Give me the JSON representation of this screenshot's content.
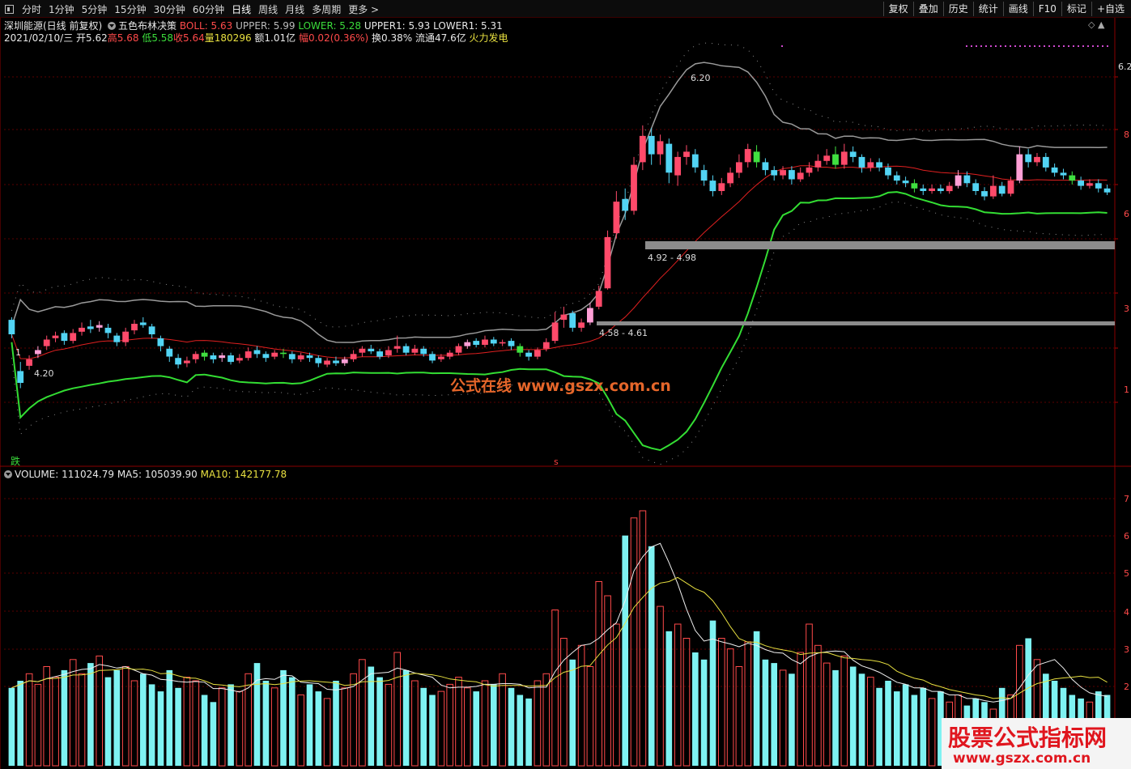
{
  "toolbar": {
    "periods": [
      "分时",
      "1分钟",
      "5分钟",
      "15分钟",
      "30分钟",
      "60分钟",
      "日线",
      "周线",
      "月线",
      "多周期",
      "更多 >"
    ],
    "active_period": "日线",
    "right_buttons": [
      "复权",
      "叠加",
      "历史",
      "统计",
      "画线",
      "F10",
      "标记",
      "+自选"
    ]
  },
  "header": {
    "stock": "深圳能源(日线 前复权)",
    "indicator": "五色布林决策",
    "boll": "BOLL: 5.63",
    "upper": "UPPER: 5.99",
    "lower": "LOWER: 5.28",
    "upper1": "UPPER1: 5.93",
    "lower1": "LOWER1: 5.31",
    "date_open": "2021/02/10/三 开5.62",
    "high": "高5.68",
    "low": "低5.58",
    "close": "收5.64",
    "volume": "量180296",
    "amount": "额1.01亿",
    "change": "幅0.02(0.36%)",
    "turnover": "换0.38%",
    "float": "流通47.6亿",
    "sector": "火力发电",
    "ctrl": "◇ ▲"
  },
  "volume_header": {
    "volume": "VOLUME: 111024.79",
    "ma5": "MA5: 105039.90",
    "ma10": "MA10: 142177.78"
  },
  "annotations": {
    "high_label": "6.20",
    "low_label": "4.20",
    "zone_upper": "4.92 - 4.98",
    "zone_lower": "4.58 - 4.61",
    "left_marker": "1",
    "die": "跌",
    "s_mark": "s"
  },
  "price_axis": [
    "6.20",
    "8",
    "6",
    "3",
    "1"
  ],
  "volume_axis": [
    "7",
    "6",
    "5",
    "4",
    "3",
    "2"
  ],
  "watermark": "公式在线  www.gszx.com.cn",
  "brand": {
    "name": "股票公式指标网",
    "url": "www.gszx.com.cn"
  },
  "colors": {
    "up": "#ff4a6a",
    "down": "#52d4f4",
    "doji_up": "#ff9fd6",
    "mid": "#40e040",
    "boll_mid": "#e02020",
    "upper": "#9a9a9a",
    "lower": "#33dd33"
  },
  "chart_data": {
    "type": "candlestick",
    "ylim": [
      4.0,
      6.6
    ],
    "candles": [
      [
        4.72,
        4.61,
        4.74,
        4.58
      ],
      [
        4.33,
        4.24,
        4.4,
        4.2
      ],
      [
        4.37,
        4.42,
        4.45,
        4.34
      ],
      [
        4.46,
        4.49,
        4.52,
        4.43
      ],
      [
        4.52,
        4.57,
        4.6,
        4.49
      ],
      [
        4.58,
        4.6,
        4.63,
        4.55
      ],
      [
        4.62,
        4.56,
        4.64,
        4.53
      ],
      [
        4.56,
        4.62,
        4.65,
        4.54
      ],
      [
        4.63,
        4.66,
        4.7,
        4.6
      ],
      [
        4.67,
        4.65,
        4.72,
        4.62
      ],
      [
        4.66,
        4.68,
        4.71,
        4.63
      ],
      [
        4.66,
        4.62,
        4.69,
        4.58
      ],
      [
        4.6,
        4.55,
        4.62,
        4.52
      ],
      [
        4.55,
        4.63,
        4.66,
        4.52
      ],
      [
        4.64,
        4.69,
        4.72,
        4.61
      ],
      [
        4.7,
        4.68,
        4.74,
        4.66
      ],
      [
        4.67,
        4.61,
        4.69,
        4.58
      ],
      [
        4.58,
        4.52,
        4.6,
        4.48
      ],
      [
        4.5,
        4.44,
        4.52,
        4.4
      ],
      [
        4.43,
        4.38,
        4.46,
        4.35
      ],
      [
        4.39,
        4.41,
        4.44,
        4.36
      ],
      [
        4.42,
        4.46,
        4.48,
        4.39
      ],
      [
        4.47,
        4.44,
        4.49,
        4.41
      ],
      [
        4.45,
        4.42,
        4.47,
        4.39
      ],
      [
        4.43,
        4.45,
        4.47,
        4.4
      ],
      [
        4.45,
        4.4,
        4.47,
        4.38
      ],
      [
        4.41,
        4.43,
        4.46,
        4.39
      ],
      [
        4.43,
        4.48,
        4.51,
        4.41
      ],
      [
        4.49,
        4.46,
        4.52,
        4.43
      ],
      [
        4.46,
        4.43,
        4.48,
        4.4
      ],
      [
        4.44,
        4.47,
        4.49,
        4.42
      ],
      [
        4.47,
        4.46,
        4.5,
        4.43
      ],
      [
        4.46,
        4.42,
        4.48,
        4.39
      ],
      [
        4.42,
        4.45,
        4.47,
        4.4
      ],
      [
        4.45,
        4.43,
        4.47,
        4.4
      ],
      [
        4.43,
        4.39,
        4.45,
        4.36
      ],
      [
        4.38,
        4.41,
        4.43,
        4.36
      ],
      [
        4.41,
        4.39,
        4.44,
        4.37
      ],
      [
        4.39,
        4.42,
        4.44,
        4.37
      ],
      [
        4.42,
        4.46,
        4.49,
        4.4
      ],
      [
        4.47,
        4.5,
        4.52,
        4.44
      ],
      [
        4.5,
        4.48,
        4.53,
        4.46
      ],
      [
        4.48,
        4.44,
        4.5,
        4.42
      ],
      [
        4.45,
        4.49,
        4.52,
        4.43
      ],
      [
        4.5,
        4.52,
        4.6,
        4.47
      ],
      [
        4.52,
        4.47,
        4.54,
        4.45
      ],
      [
        4.47,
        4.5,
        4.53,
        4.45
      ],
      [
        4.5,
        4.46,
        4.52,
        4.44
      ],
      [
        4.46,
        4.41,
        4.48,
        4.39
      ],
      [
        4.42,
        4.44,
        4.46,
        4.4
      ],
      [
        4.44,
        4.47,
        4.49,
        4.42
      ],
      [
        4.47,
        4.52,
        4.54,
        4.45
      ],
      [
        4.52,
        4.55,
        4.57,
        4.5
      ],
      [
        4.56,
        4.53,
        4.58,
        4.51
      ],
      [
        4.53,
        4.57,
        4.6,
        4.51
      ],
      [
        4.57,
        4.54,
        4.59,
        4.52
      ],
      [
        4.54,
        4.55,
        4.57,
        4.52
      ],
      [
        4.56,
        4.52,
        4.58,
        4.49
      ],
      [
        4.52,
        4.47,
        4.54,
        4.44
      ],
      [
        4.47,
        4.44,
        4.49,
        4.41
      ],
      [
        4.44,
        4.49,
        4.51,
        4.42
      ],
      [
        4.5,
        4.55,
        4.58,
        4.48
      ],
      [
        4.56,
        4.7,
        4.78,
        4.54
      ],
      [
        4.72,
        4.76,
        4.82,
        4.66
      ],
      [
        4.77,
        4.66,
        4.79,
        4.63
      ],
      [
        4.66,
        4.7,
        4.73,
        4.63
      ],
      [
        4.7,
        4.81,
        4.85,
        4.68
      ],
      [
        4.82,
        4.94,
        4.98,
        4.8
      ],
      [
        4.96,
        5.35,
        5.4,
        4.95
      ],
      [
        5.38,
        5.62,
        5.7,
        5.34
      ],
      [
        5.64,
        5.55,
        5.72,
        5.48
      ],
      [
        5.55,
        5.9,
        5.96,
        5.52
      ],
      [
        5.92,
        6.12,
        6.2,
        5.86
      ],
      [
        6.12,
        5.98,
        6.18,
        5.9
      ],
      [
        5.98,
        6.08,
        6.13,
        5.9
      ],
      [
        6.06,
        5.84,
        6.1,
        5.76
      ],
      [
        5.82,
        5.96,
        6.0,
        5.74
      ],
      [
        5.96,
        6.0,
        6.05,
        5.9
      ],
      [
        5.98,
        5.88,
        6.02,
        5.84
      ],
      [
        5.86,
        5.78,
        5.9,
        5.74
      ],
      [
        5.78,
        5.7,
        5.82,
        5.66
      ],
      [
        5.7,
        5.76,
        5.8,
        5.67
      ],
      [
        5.76,
        5.84,
        5.88,
        5.73
      ],
      [
        5.84,
        5.92,
        5.98,
        5.8
      ],
      [
        5.92,
        6.02,
        6.06,
        5.88
      ],
      [
        6.0,
        5.92,
        6.05,
        5.88
      ],
      [
        5.92,
        5.86,
        5.95,
        5.82
      ],
      [
        5.86,
        5.82,
        5.89,
        5.78
      ],
      [
        5.82,
        5.86,
        5.89,
        5.79
      ],
      [
        5.86,
        5.79,
        5.89,
        5.75
      ],
      [
        5.79,
        5.84,
        5.88,
        5.77
      ],
      [
        5.84,
        5.88,
        5.92,
        5.81
      ],
      [
        5.88,
        5.93,
        5.98,
        5.85
      ],
      [
        5.93,
        5.97,
        6.02,
        5.9
      ],
      [
        5.98,
        5.9,
        6.04,
        5.87
      ],
      [
        5.9,
        6.0,
        6.06,
        5.87
      ],
      [
        6.0,
        5.96,
        6.04,
        5.92
      ],
      [
        5.96,
        5.88,
        5.98,
        5.84
      ],
      [
        5.88,
        5.92,
        5.95,
        5.85
      ],
      [
        5.92,
        5.88,
        5.95,
        5.85
      ],
      [
        5.88,
        5.82,
        5.91,
        5.79
      ],
      [
        5.82,
        5.78,
        5.85,
        5.75
      ],
      [
        5.78,
        5.76,
        5.81,
        5.73
      ],
      [
        5.76,
        5.72,
        5.79,
        5.69
      ],
      [
        5.72,
        5.7,
        5.75,
        5.67
      ],
      [
        5.7,
        5.72,
        5.75,
        5.68
      ],
      [
        5.72,
        5.7,
        5.75,
        5.68
      ],
      [
        5.7,
        5.74,
        5.77,
        5.68
      ],
      [
        5.74,
        5.82,
        5.86,
        5.72
      ],
      [
        5.82,
        5.76,
        5.85,
        5.73
      ],
      [
        5.76,
        5.7,
        5.79,
        5.67
      ],
      [
        5.7,
        5.66,
        5.73,
        5.63
      ],
      [
        5.66,
        5.74,
        5.82,
        5.64
      ],
      [
        5.74,
        5.68,
        5.77,
        5.66
      ],
      [
        5.68,
        5.78,
        5.81,
        5.66
      ],
      [
        5.78,
        5.98,
        6.04,
        5.76
      ],
      [
        5.98,
        5.92,
        6.02,
        5.88
      ],
      [
        5.92,
        5.96,
        5.99,
        5.89
      ],
      [
        5.96,
        5.88,
        5.99,
        5.85
      ],
      [
        5.88,
        5.84,
        5.91,
        5.81
      ],
      [
        5.84,
        5.82,
        5.87,
        5.79
      ],
      [
        5.82,
        5.78,
        5.85,
        5.75
      ],
      [
        5.78,
        5.74,
        5.81,
        5.71
      ],
      [
        5.74,
        5.76,
        5.79,
        5.72
      ],
      [
        5.76,
        5.72,
        5.79,
        5.69
      ],
      [
        5.72,
        5.69,
        5.75,
        5.67
      ]
    ],
    "volume": [
      22,
      24,
      26,
      23,
      28,
      25,
      27,
      30,
      26,
      29,
      31,
      25,
      27,
      28,
      24,
      26,
      23,
      21,
      27,
      22,
      25,
      24,
      20,
      18,
      22,
      23,
      21,
      26,
      29,
      24,
      22,
      27,
      25,
      20,
      23,
      21,
      19,
      24,
      22,
      26,
      30,
      28,
      25,
      23,
      32,
      27,
      24,
      22,
      20,
      21,
      23,
      25,
      22,
      21,
      24,
      23,
      26,
      22,
      20,
      19,
      24,
      26,
      44,
      36,
      30,
      34,
      28,
      52,
      48,
      40,
      65,
      70,
      72,
      62,
      45,
      38,
      40,
      36,
      32,
      30,
      41,
      36,
      33,
      28,
      35,
      38,
      30,
      29,
      27,
      26,
      32,
      40,
      34,
      29,
      27,
      31,
      28,
      26,
      25,
      22,
      24,
      21,
      23,
      20,
      22,
      19,
      21,
      18,
      20,
      17,
      19,
      18,
      16,
      22,
      20,
      34,
      36,
      30,
      26,
      24,
      22,
      20,
      19,
      18,
      21,
      20
    ]
  }
}
